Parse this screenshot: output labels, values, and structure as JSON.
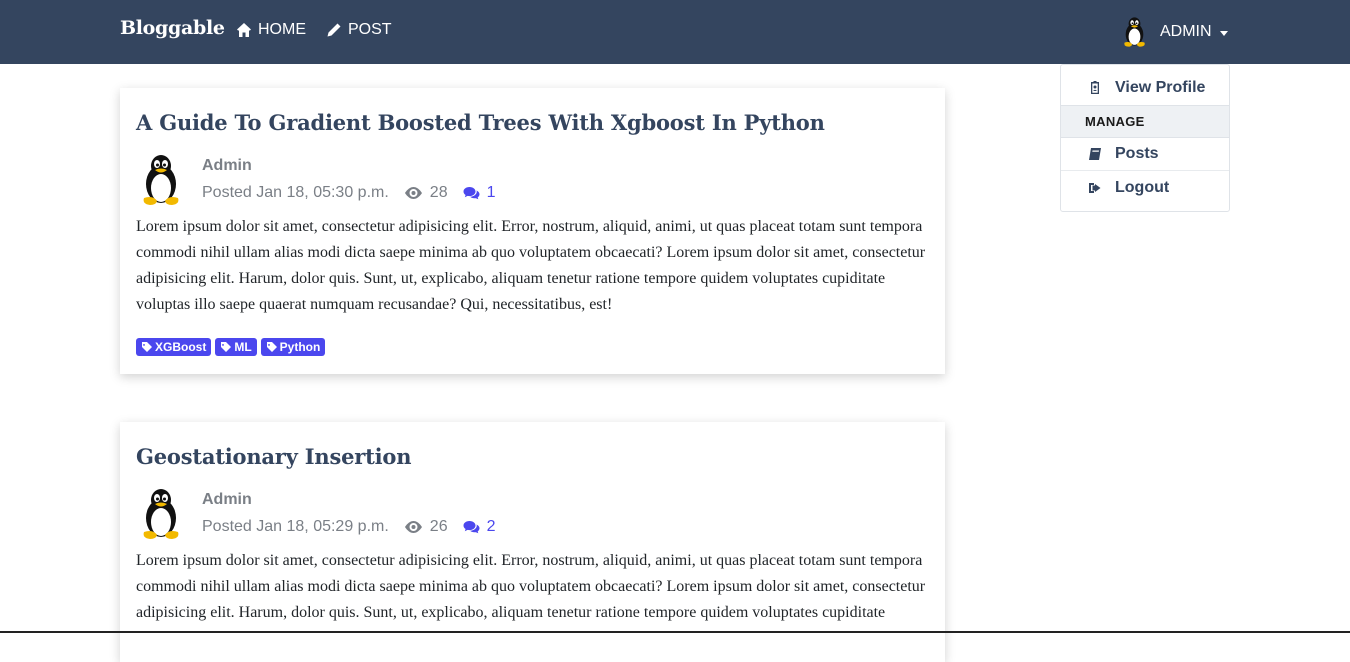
{
  "navbar": {
    "brand": "Bloggable",
    "home_label": "HOME",
    "post_label": "POST",
    "user_label": "ADMIN",
    "bg_color": "#34455f"
  },
  "dropdown": {
    "view_profile": "View Profile",
    "manage_header": "MANAGE",
    "posts": "Posts",
    "logout": "Logout"
  },
  "posts": [
    {
      "title": "A Guide To Gradient Boosted Trees With Xgboost In Python",
      "author": "Admin",
      "posted": "Posted Jan 18, 05:30 p.m.",
      "views": "28",
      "comments": "1",
      "body": "Lorem ipsum dolor sit amet, consectetur adipisicing elit. Error, nostrum, aliquid, animi, ut quas placeat totam sunt tempora commodi nihil ullam alias modi dicta saepe minima ab quo voluptatem obcaecati? Lorem ipsum dolor sit amet, consectetur adipisicing elit. Harum, dolor quis. Sunt, ut, explicabo, aliquam tenetur ratione tempore quidem voluptates cupiditate voluptas illo saepe quaerat numquam recusandae? Qui, necessitatibus, est!",
      "tags": [
        "XGBoost",
        "ML",
        "Python"
      ]
    },
    {
      "title": "Geostationary Insertion",
      "author": "Admin",
      "posted": "Posted Jan 18, 05:29 p.m.",
      "views": "26",
      "comments": "2",
      "body": "Lorem ipsum dolor sit amet, consectetur adipisicing elit. Error, nostrum, aliquid, animi, ut quas placeat totam sunt tempora commodi nihil ullam alias modi dicta saepe minima ab quo voluptatem obcaecati? Lorem ipsum dolor sit amet, consectetur adipisicing elit. Harum, dolor quis. Sunt, ut, explicabo, aliquam tenetur ratione tempore quidem voluptates cupiditate"
    }
  ],
  "colors": {
    "accent": "#4b47ee",
    "title": "#34455f",
    "muted": "#7a7f86"
  }
}
